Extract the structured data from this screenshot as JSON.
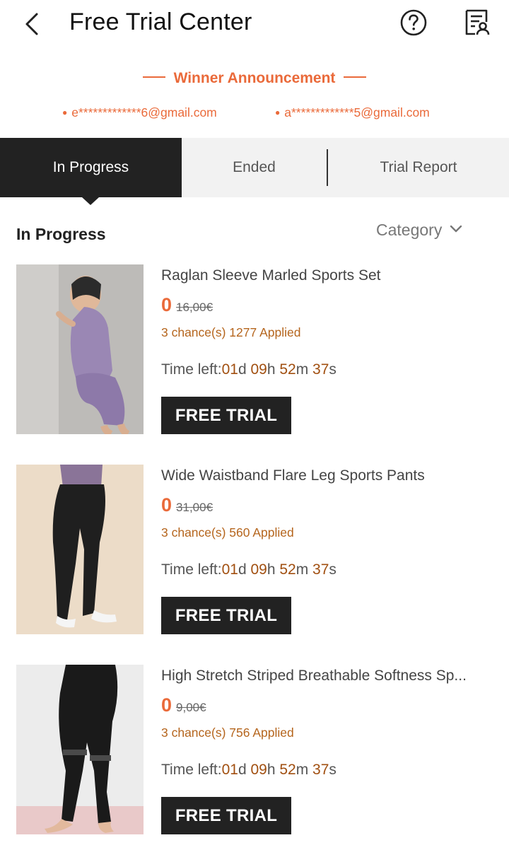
{
  "header": {
    "title": "Free Trial Center",
    "back_icon": "chevron-left-icon",
    "help_icon": "question-circle-icon",
    "report_icon": "document-user-icon"
  },
  "winner": {
    "title": "Winner Announcement",
    "emails": [
      "e*************6@gmail.com",
      "a*************5@gmail.com"
    ]
  },
  "tabs": [
    {
      "label": "In Progress",
      "active": true
    },
    {
      "label": "Ended",
      "active": false
    },
    {
      "label": "Trial Report",
      "active": false
    }
  ],
  "section": {
    "title": "In Progress",
    "category_label": "Category"
  },
  "colors": {
    "accent": "#ea6a3a",
    "dark": "#222222",
    "time_num": "#a14f10"
  },
  "products": [
    {
      "name": "Raglan Sleeve Marled Sports Set",
      "price": "0",
      "old_price": "16,00€",
      "chances": "3 chance(s) 1277 Applied",
      "time_prefix": "Time left:",
      "days": "01",
      "hours": "09",
      "minutes": "52",
      "seconds": "37",
      "button": "FREE TRIAL"
    },
    {
      "name": "Wide Waistband Flare Leg Sports Pants",
      "price": "0",
      "old_price": "31,00€",
      "chances": "3 chance(s) 560 Applied",
      "time_prefix": "Time left:",
      "days": "01",
      "hours": "09",
      "minutes": "52",
      "seconds": "37",
      "button": "FREE TRIAL"
    },
    {
      "name": "High Stretch Striped Breathable Softness Sp...",
      "price": "0",
      "old_price": "9,00€",
      "chances": "3 chance(s) 756 Applied",
      "time_prefix": "Time left:",
      "days": "01",
      "hours": "09",
      "minutes": "52",
      "seconds": "37",
      "button": "FREE TRIAL"
    }
  ]
}
